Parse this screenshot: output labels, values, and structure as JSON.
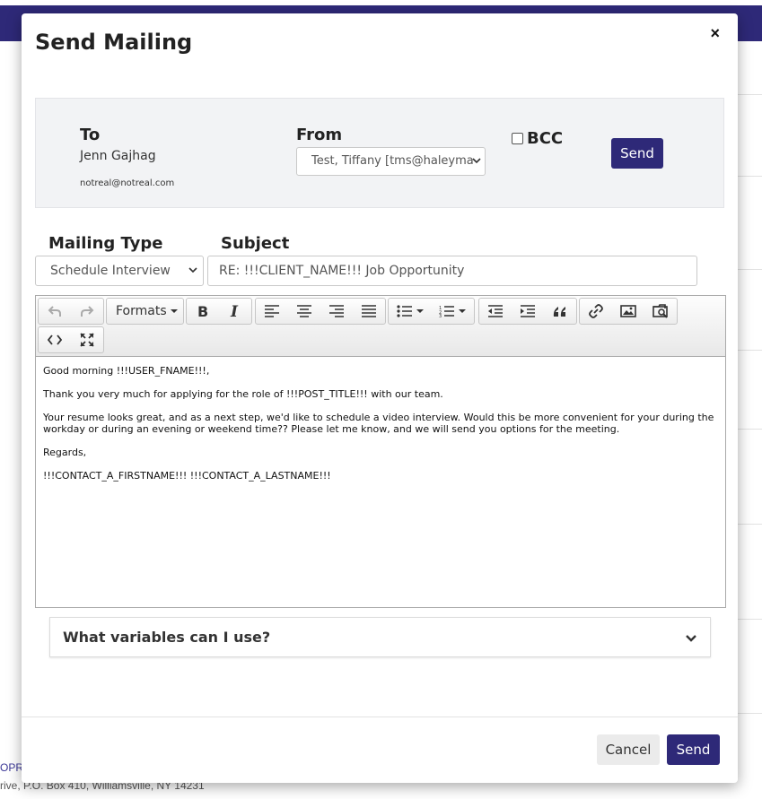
{
  "background": {
    "footer_link": "OPR",
    "footer_address": "rive, P.O. Box 410, Williamsville, NY 14231"
  },
  "modal": {
    "title": "Send Mailing",
    "close": "×"
  },
  "recipient": {
    "to_label": "To",
    "to_name": "Jenn Gajhag",
    "to_email": "notreal@notreal.com",
    "from_label": "From",
    "from_value": "Test, Tiffany [tms@haleyma",
    "bcc_label": "BCC",
    "send_label": "Send"
  },
  "fields": {
    "mailing_type_label": "Mailing Type",
    "mailing_type_value": "Schedule Interview",
    "subject_label": "Subject",
    "subject_value": "RE: !!!CLIENT_NAME!!! Job Opportunity"
  },
  "toolbar": {
    "formats_label": "Formats"
  },
  "editor": {
    "paragraphs": [
      "Good morning !!!USER_FNAME!!!,",
      "Thank you very much for applying for the role of !!!POST_TITLE!!! with our team.",
      "Your resume looks great, and as a next step, we'd like to schedule a video interview. Would this be more convenient for your during the workday or during an evening or weekend time?? Please let me know, and we will send you options for the meeting.",
      "Regards,",
      "!!!CONTACT_A_FIRSTNAME!!! !!!CONTACT_A_LASTNAME!!!"
    ]
  },
  "accordion": {
    "label": "What variables can I use?"
  },
  "footer": {
    "cancel_label": "Cancel",
    "send_label": "Send"
  },
  "colors": {
    "brand": "#2e2978",
    "panel_bg": "#f2f3f5"
  }
}
